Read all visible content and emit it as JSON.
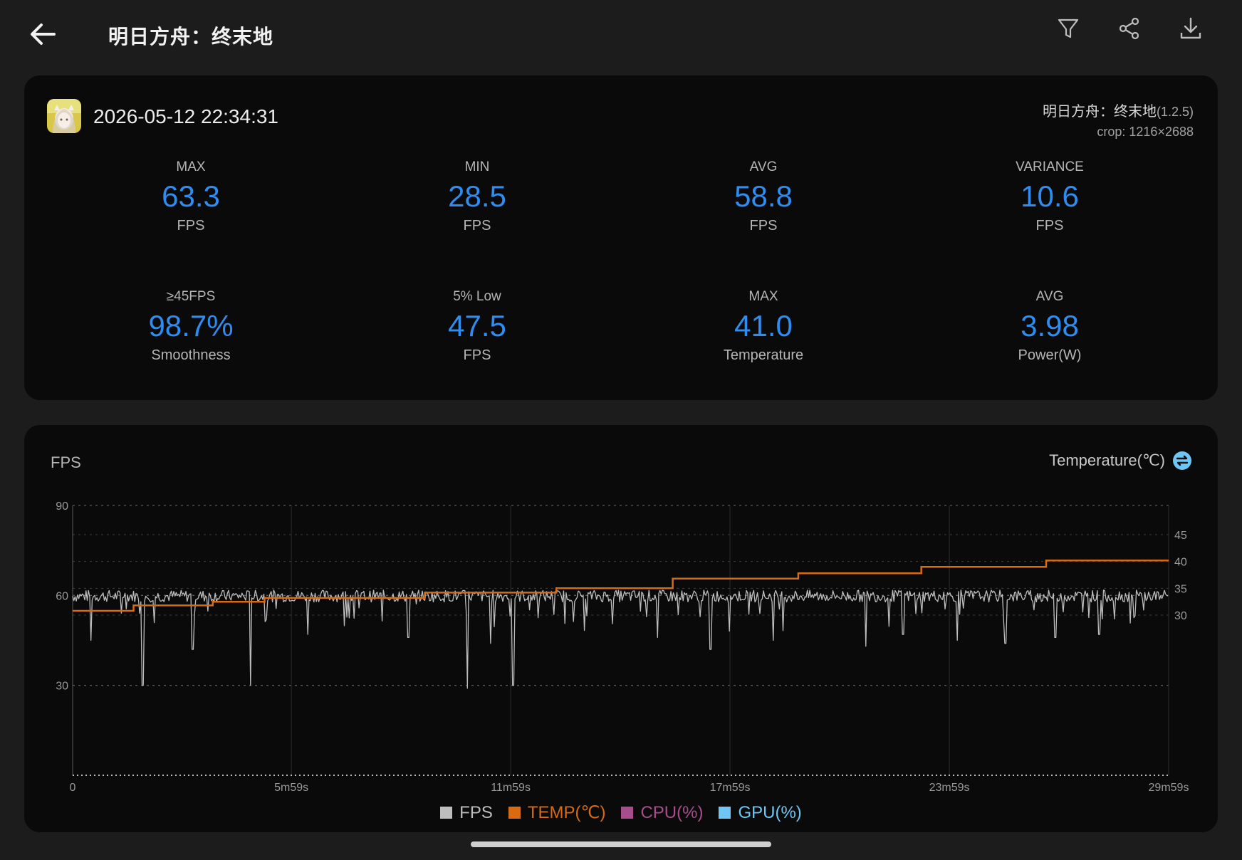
{
  "header": {
    "title": "明日方舟：终末地"
  },
  "summary": {
    "timestamp": "2026-05-12 22:34:31",
    "app_name": "明日方舟：终末地",
    "app_version": "(1.2.5)",
    "crop": "crop: 1216×2688",
    "stats": [
      {
        "label": "MAX",
        "value": "63.3",
        "unit": "FPS"
      },
      {
        "label": "MIN",
        "value": "28.5",
        "unit": "FPS"
      },
      {
        "label": "AVG",
        "value": "58.8",
        "unit": "FPS"
      },
      {
        "label": "VARIANCE",
        "value": "10.6",
        "unit": "FPS"
      },
      {
        "label": "≥45FPS",
        "value": "98.7%",
        "unit": "Smoothness"
      },
      {
        "label": "5% Low",
        "value": "47.5",
        "unit": "FPS"
      },
      {
        "label": "MAX",
        "value": "41.0",
        "unit": "Temperature"
      },
      {
        "label": "AVG",
        "value": "3.98",
        "unit": "Power(W)"
      }
    ]
  },
  "chart": {
    "left_label": "FPS",
    "right_label": "Temperature(℃)",
    "legend": [
      {
        "label": "FPS",
        "color": "#bdbdbd"
      },
      {
        "label": "TEMP(℃)",
        "color": "#d86a12"
      },
      {
        "label": "CPU(%)",
        "color": "#a84d8c"
      },
      {
        "label": "GPU(%)",
        "color": "#6ec6f5"
      }
    ]
  },
  "chart_data": {
    "type": "line",
    "x_tick_labels": [
      "0",
      "5m59s",
      "11m59s",
      "17m59s",
      "23m59s",
      "29m59s"
    ],
    "x_tick_seconds": [
      0,
      359,
      719,
      1079,
      1439,
      1799
    ],
    "xlim": [
      0,
      1799
    ],
    "ylim_left": [
      0,
      90
    ],
    "left_ticks": [
      "90",
      "60",
      "30"
    ],
    "right_ticks": [
      "45",
      "40",
      "35",
      "30"
    ],
    "ylim_right_visible": [
      30,
      45
    ],
    "grid": true,
    "series": [
      {
        "name": "FPS",
        "color": "#bdbdbd",
        "axis": "left",
        "typical_value": 60,
        "max": 63.3,
        "min": 28.5,
        "avg": 58.8,
        "dips": [
          [
            30,
            45
          ],
          [
            115,
            30
          ],
          [
            197,
            42
          ],
          [
            292,
            30
          ],
          [
            386,
            47
          ],
          [
            551,
            46
          ],
          [
            648,
            29
          ],
          [
            686,
            44
          ],
          [
            723,
            30
          ],
          [
            960,
            46
          ],
          [
            1047,
            42
          ],
          [
            1150,
            45
          ],
          [
            1302,
            43
          ],
          [
            1363,
            47
          ],
          [
            1452,
            45
          ],
          [
            1531,
            44
          ],
          [
            1613,
            46
          ],
          [
            1685,
            47
          ]
        ]
      },
      {
        "name": "TEMP(℃)",
        "color": "#d86a12",
        "axis": "right",
        "steps": [
          [
            0,
            30.8
          ],
          [
            100,
            31.8
          ],
          [
            230,
            32.5
          ],
          [
            315,
            33.2
          ],
          [
            578,
            34.2
          ],
          [
            794,
            35.0
          ],
          [
            985,
            36.8
          ],
          [
            1191,
            37.8
          ],
          [
            1393,
            39.0
          ],
          [
            1598,
            40.2
          ],
          [
            1799,
            40.2
          ]
        ]
      }
    ]
  }
}
